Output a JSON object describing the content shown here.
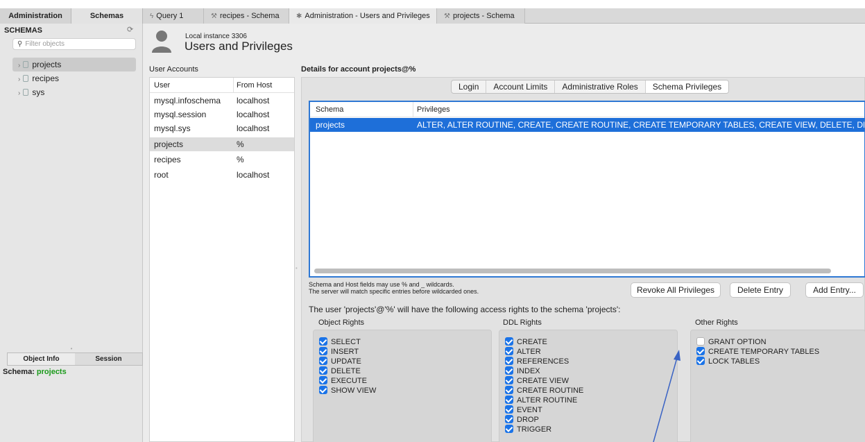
{
  "sidebar_tabs": [
    "Administration",
    "Schemas"
  ],
  "doc_tabs": [
    {
      "icon": "lightning-icon",
      "label": "Query 1"
    },
    {
      "icon": "wrench-icon",
      "label": "recipes - Schema"
    },
    {
      "icon": "gear-icon",
      "label": "Administration - Users and Privileges"
    },
    {
      "icon": "wrench-icon",
      "label": "projects - Schema"
    }
  ],
  "sidebar": {
    "title": "SCHEMAS",
    "filter_placeholder": "Filter objects",
    "schemas": [
      "projects",
      "recipes",
      "sys"
    ],
    "info_tabs": [
      "Object Info",
      "Session"
    ],
    "info_label": "Schema:",
    "info_value": "projects"
  },
  "header": {
    "instance": "Local instance 3306",
    "title": "Users and Privileges"
  },
  "user_accounts": {
    "label": "User Accounts",
    "columns": [
      "User",
      "From Host"
    ],
    "rows": [
      {
        "user": "mysql.infoschema",
        "host": "localhost"
      },
      {
        "user": "mysql.session",
        "host": "localhost"
      },
      {
        "user": "mysql.sys",
        "host": "localhost"
      },
      {
        "user": "projects",
        "host": "%"
      },
      {
        "user": "recipes",
        "host": "%"
      },
      {
        "user": "root",
        "host": "localhost"
      }
    ]
  },
  "details": {
    "title": "Details for account projects@%",
    "tabs": [
      "Login",
      "Account Limits",
      "Administrative Roles",
      "Schema Privileges"
    ],
    "table_columns": [
      "Schema",
      "Privileges"
    ],
    "table_row": {
      "schema": "projects",
      "privileges": "ALTER, ALTER ROUTINE, CREATE, CREATE ROUTINE, CREATE TEMPORARY TABLES, CREATE VIEW, DELETE, DROP, EVEN"
    },
    "note_line1": "Schema and Host fields may use % and _ wildcards.",
    "note_line2": "The server will match specific entries before wildcarded ones.",
    "buttons": {
      "revoke": "Revoke All Privileges",
      "delete": "Delete Entry",
      "add": "Add Entry..."
    },
    "access_text": "The user 'projects'@'%' will have the following access rights to the schema 'projects':",
    "object_rights": {
      "label": "Object Rights",
      "items": [
        "SELECT",
        "INSERT",
        "UPDATE",
        "DELETE",
        "EXECUTE",
        "SHOW VIEW"
      ]
    },
    "ddl_rights": {
      "label": "DDL Rights",
      "items": [
        "CREATE",
        "ALTER",
        "REFERENCES",
        "INDEX",
        "CREATE VIEW",
        "CREATE ROUTINE",
        "ALTER ROUTINE",
        "EVENT",
        "DROP",
        "TRIGGER"
      ]
    },
    "other_rights": {
      "label": "Other Rights",
      "items": [
        {
          "label": "GRANT OPTION",
          "checked": false
        },
        {
          "label": "CREATE TEMPORARY TABLES",
          "checked": true
        },
        {
          "label": "LOCK TABLES",
          "checked": true
        }
      ]
    }
  },
  "colors": {
    "selection_blue": "#1e6fd9",
    "checkbox_blue": "#1a73e8",
    "arrow_blue": "#3a63c4",
    "schema_green": "#1a9a1a"
  }
}
